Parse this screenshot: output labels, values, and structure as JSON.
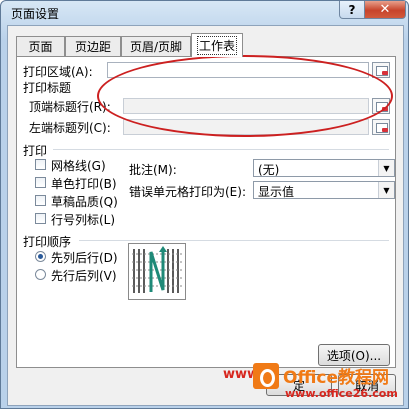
{
  "window": {
    "title": "页面设置",
    "help_label": "?",
    "close_label": "✕"
  },
  "tabs": [
    {
      "label": "页面",
      "active": false
    },
    {
      "label": "页边距",
      "active": false
    },
    {
      "label": "页眉/页脚",
      "active": false
    },
    {
      "label": "工作表",
      "active": true
    }
  ],
  "sheet": {
    "print_area_label": "打印区域(A):",
    "print_titles_label": "打印标题",
    "top_rows_label": "顶端标题行(R):",
    "left_cols_label": "左端标题列(C):",
    "print_section_label": "打印",
    "checkboxes": [
      {
        "label": "网格线(G)",
        "checked": false
      },
      {
        "label": "单色打印(B)",
        "checked": false
      },
      {
        "label": "草稿品质(Q)",
        "checked": false
      },
      {
        "label": "行号列标(L)",
        "checked": false
      }
    ],
    "comments_label": "批注(M):",
    "comments_value": "(无)",
    "errors_label": "错误单元格打印为(E):",
    "errors_value": "显示值",
    "order_label": "打印顺序",
    "order_options": [
      {
        "label": "先列后行(D)",
        "selected": true
      },
      {
        "label": "先行后列(V)",
        "selected": false
      }
    ]
  },
  "buttons": {
    "options_label": "选项(O)...",
    "ok_fragment": "定",
    "cancel_fragment": "取消"
  },
  "watermark": {
    "site_prefix": "www.",
    "brand": "Office教程网",
    "url": "www.office26.com"
  },
  "colors": {
    "annotation": "#cc2020",
    "watermark_red": "#d7261e",
    "watermark_orange": "#f07a16"
  }
}
